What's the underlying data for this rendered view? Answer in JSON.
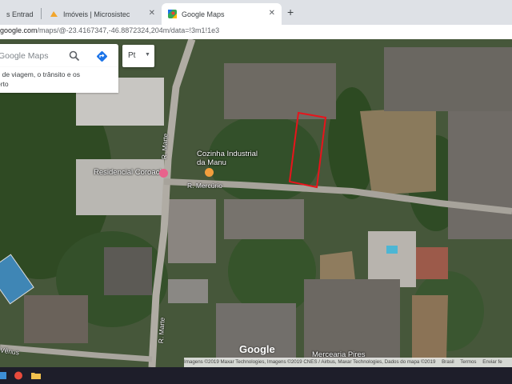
{
  "tabs": [
    {
      "title": "s Entrada",
      "icon": "mail-icon"
    },
    {
      "title": "Imóveis | Microsistec",
      "icon": "microsistec-icon"
    },
    {
      "title": "Google Maps",
      "icon": "google-maps-icon",
      "active": true
    }
  ],
  "address_bar": {
    "url_domain": "google.com",
    "url_path": "/maps/@-23.4167347,-46.8872324,204m/data=!3m1!1e3"
  },
  "search": {
    "placeholder": "Google Maps"
  },
  "tip": {
    "line1": "s de viagem, o trânsito e os",
    "line2": "erto"
  },
  "layers": {
    "label": "Pt"
  },
  "map_labels": {
    "r_marte_top": "R. Marte",
    "r_marte_bottom": "R. Marte",
    "r_mercurio": "R. Mercúrio",
    "residencial": "Residencial Coroaci",
    "cozinha_line1": "Cozinha Industrial",
    "cozinha_line2": "da Manu",
    "mercearia": "Mercearia Pires",
    "venus": "Vênus"
  },
  "logo": "Google",
  "attribution": {
    "imagery": "Imagens ©2019 Maxar Technologies, Imagens ©2019 CNES / Airbus, Maxar Technologies, Dados do mapa ©2019",
    "country": "Brasil",
    "terms": "Termos",
    "feedback": "Enviar fe"
  },
  "colors": {
    "accent": "#1a73e8",
    "highlight": "#e8141b",
    "poi_orange": "#f29e3d",
    "poi_pink": "#e8638c"
  }
}
